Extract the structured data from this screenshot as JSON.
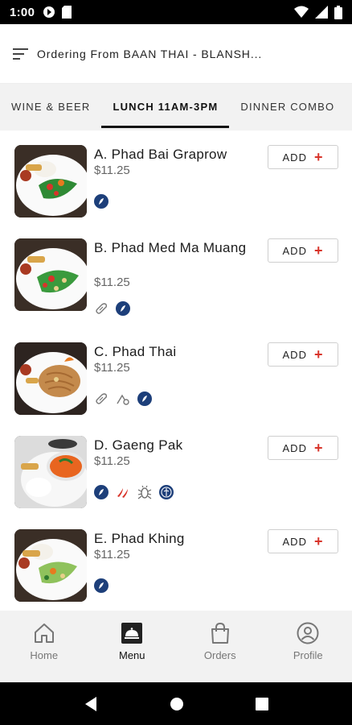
{
  "status_bar": {
    "time": "1:00"
  },
  "header": {
    "title": "Ordering From BAAN THAI - BLANSH..."
  },
  "tabs": [
    {
      "label": "WINE & BEER"
    },
    {
      "label": "LUNCH 11AM-3PM"
    },
    {
      "label": "DINNER COMBO"
    }
  ],
  "menu": {
    "add_label": "ADD",
    "add_plus": "+",
    "items": [
      {
        "name": "A. Phad Bai Graprow",
        "price": "$11.25",
        "tags": [
          "gluten-free-icon"
        ]
      },
      {
        "name": "B. Phad Med Ma Muang",
        "price": "$11.25",
        "tags": [
          "nuts-icon",
          "gluten-free-icon"
        ]
      },
      {
        "name": "C. Phad Thai",
        "price": "$11.25",
        "tags": [
          "nuts-icon",
          "egg-icon",
          "gluten-free-icon"
        ]
      },
      {
        "name": "D. Gaeng Pak",
        "price": "$11.25",
        "tags": [
          "gluten-free-icon",
          "spicy-icon",
          "vegetarian-icon",
          "vegan-icon"
        ]
      },
      {
        "name": "E. Phad Khing",
        "price": "$11.25",
        "tags": [
          "gluten-free-icon"
        ]
      }
    ]
  },
  "bottom_nav": [
    {
      "label": "Home",
      "icon": "home-icon"
    },
    {
      "label": "Menu",
      "icon": "menu-icon",
      "active": true
    },
    {
      "label": "Orders",
      "icon": "bag-icon"
    },
    {
      "label": "Profile",
      "icon": "profile-icon"
    }
  ],
  "colors": {
    "accent": "#d8342a",
    "tag_blue": "#1d3f7a",
    "nav_bg": "#f2f2f2"
  }
}
